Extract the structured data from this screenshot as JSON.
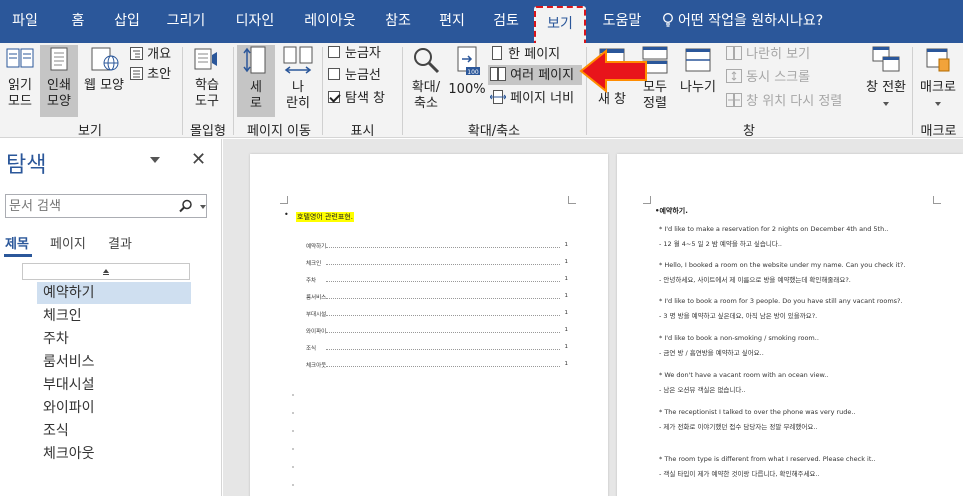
{
  "menu": {
    "tabs": [
      "파일",
      "홈",
      "삽입",
      "그리기",
      "디자인",
      "레이아웃",
      "참조",
      "편지",
      "검토",
      "보기",
      "도움말"
    ],
    "active_tab": "보기",
    "tell_me": "어떤 작업을 원하시나요?"
  },
  "ribbon": {
    "views": {
      "read_mode": [
        "읽기",
        "모드"
      ],
      "print_layout": [
        "인쇄",
        "모양"
      ],
      "web_layout": "웹 모양",
      "outline": "개요",
      "draft": "초안",
      "label": "보기"
    },
    "immersive": {
      "learning_tools": [
        "학습",
        "도구"
      ],
      "label": "몰입형"
    },
    "page_movement": {
      "vertical": [
        "세",
        "로"
      ],
      "side_to_side": [
        "나",
        "란히"
      ],
      "label": "페이지 이동"
    },
    "show": {
      "ruler": "눈금자",
      "gridlines": "눈금선",
      "nav_pane": "탐색 창",
      "label": "표시"
    },
    "zoom": {
      "zoom": [
        "확대/",
        "축소"
      ],
      "hundred": "100%",
      "one_page": "한 페이지",
      "multiple_pages": "여러 페이지",
      "page_width": "페이지 너비",
      "label": "확대/축소"
    },
    "window": {
      "new_window": "새 창",
      "arrange_all": [
        "모두",
        "정렬"
      ],
      "split": "나누기",
      "view_side_by_side": "나란히 보기",
      "sync_scroll": "동시 스크롤",
      "reset_position": "창 위치 다시 정렬",
      "switch_windows": "창 전환",
      "label": "창"
    },
    "macros": {
      "macros": "매크로",
      "label": "매크로"
    }
  },
  "nav_pane": {
    "title": "탐색",
    "search_placeholder": "문서 검색",
    "tabs": [
      "제목",
      "페이지",
      "결과"
    ],
    "headings": [
      "예약하기",
      "체크인",
      "주차",
      "룸서비스",
      "부대시설",
      "와이파이",
      "조식",
      "체크아웃"
    ]
  },
  "page1": {
    "title": "호텔영어 관련표현.",
    "toc": [
      {
        "label": "예약하기",
        "page": "1"
      },
      {
        "label": "체크인",
        "page": "1"
      },
      {
        "label": "주차",
        "page": "1"
      },
      {
        "label": "룸서비스",
        "page": "1"
      },
      {
        "label": "부대시설",
        "page": "1"
      },
      {
        "label": "와이파이",
        "page": "1"
      },
      {
        "label": "조식",
        "page": "1"
      },
      {
        "label": "체크아웃",
        "page": "1"
      }
    ]
  },
  "page2": {
    "title": "예약하기.",
    "lines": [
      "* I'd like to make a reservation for 2 nights on December 4th and 5th..",
      "- 12 월 4~5 일 2 밤 예약을 하고 싶습니다..",
      "* Hello, I booked a room on the website under my name. Can you check it?.",
      "- 안녕하세요, 사이트에서 제 이름으로 방을 예약했는데 확인해줄래요?.",
      "* I'd like to book a room for 3 people. Do you have still any vacant rooms?.",
      "- 3 명 방을 예약하고 싶은데요, 아직 남은 방이 있을까요?.",
      "* I'd like to book a non-smoking / smoking room..",
      "- 금연 방 / 흡연방을 예약하고 싶어요..",
      "* We don't have a vacant room with an ocean view..",
      "- 남은 오션뷰 객실은 없습니다..",
      "* The receptionist I talked to over the phone was very rude..",
      "- 제가 전화로 이야기했던 접수 담당자는 정말 무례했어요..",
      "* The room type is different from what I reserved. Please check it..",
      "- 객실 타입이 제가 예약한 것이랑 다릅니다, 확인해주세요.."
    ]
  }
}
